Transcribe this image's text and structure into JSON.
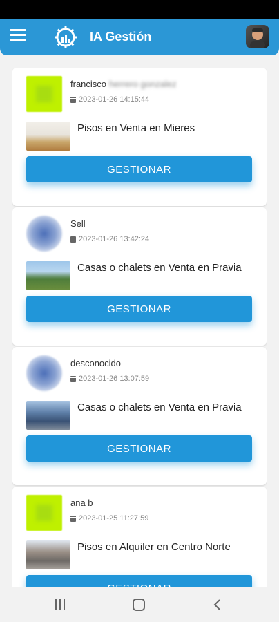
{
  "app": {
    "title": "IA Gestión"
  },
  "leads": [
    {
      "name": "francisco",
      "name_extra": "herrero gonzalez",
      "date": "2023-01-26 14:15:44",
      "title": "Pisos en Venta en Mieres",
      "action": "GESTIONAR",
      "avatar": "lime-placeholder"
    },
    {
      "name": "Sell",
      "date": "2023-01-26 13:42:24",
      "title": "Casas o chalets en Venta en Pravia",
      "action": "GESTIONAR",
      "avatar": "blue-placeholder"
    },
    {
      "name": "desconocido",
      "date": "2023-01-26 13:07:59",
      "title": "Casas o chalets en Venta en Pravia",
      "action": "GESTIONAR",
      "avatar": "blue-placeholder"
    },
    {
      "name": "ana b",
      "date": "2023-01-25 11:27:59",
      "title": "Pisos en Alquiler en Centro Norte",
      "action": "GESTIONAR",
      "avatar": "lime-placeholder"
    }
  ],
  "colors": {
    "primary": "#2196d9",
    "appbar": "#2b97d6",
    "background": "#f2f2f2"
  },
  "icons": {
    "menu": "hamburger-icon",
    "logo": "gear-chart-icon",
    "calendar": "calendar-icon",
    "recent": "recent-apps-icon",
    "home": "home-icon",
    "back": "back-icon"
  }
}
